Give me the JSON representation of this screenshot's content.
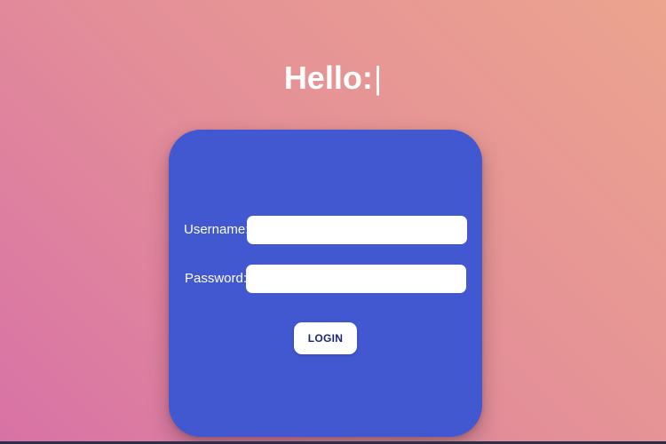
{
  "header": {
    "greeting": "Hello:",
    "caret": "|"
  },
  "login_form": {
    "username_label": "Username:",
    "username_value": "",
    "password_label": "Password:",
    "password_value": "",
    "login_button_label": "LOGIN"
  },
  "colors": {
    "background_gradient_start": "#d872a6",
    "background_gradient_end": "#eca48e",
    "card": "#4158d0",
    "button_text": "#1a237e",
    "input_background": "#ffffff"
  }
}
